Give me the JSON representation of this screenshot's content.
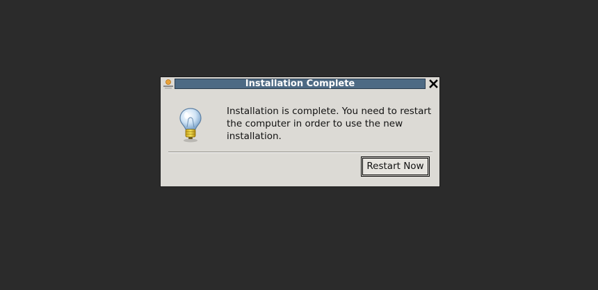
{
  "dialog": {
    "title": "Installation Complete",
    "message": "Installation is complete. You need to restart the computer in order to use the new installation.",
    "restart_label": "Restart Now",
    "icons": {
      "app": "app-logo-icon",
      "close": "close-icon",
      "info": "lightbulb-icon"
    }
  },
  "colors": {
    "desktop": "#2b2b2b",
    "dialog_bg": "#dcdad5",
    "title_strip": "#4d6a84",
    "title_text": "#ffffff"
  }
}
